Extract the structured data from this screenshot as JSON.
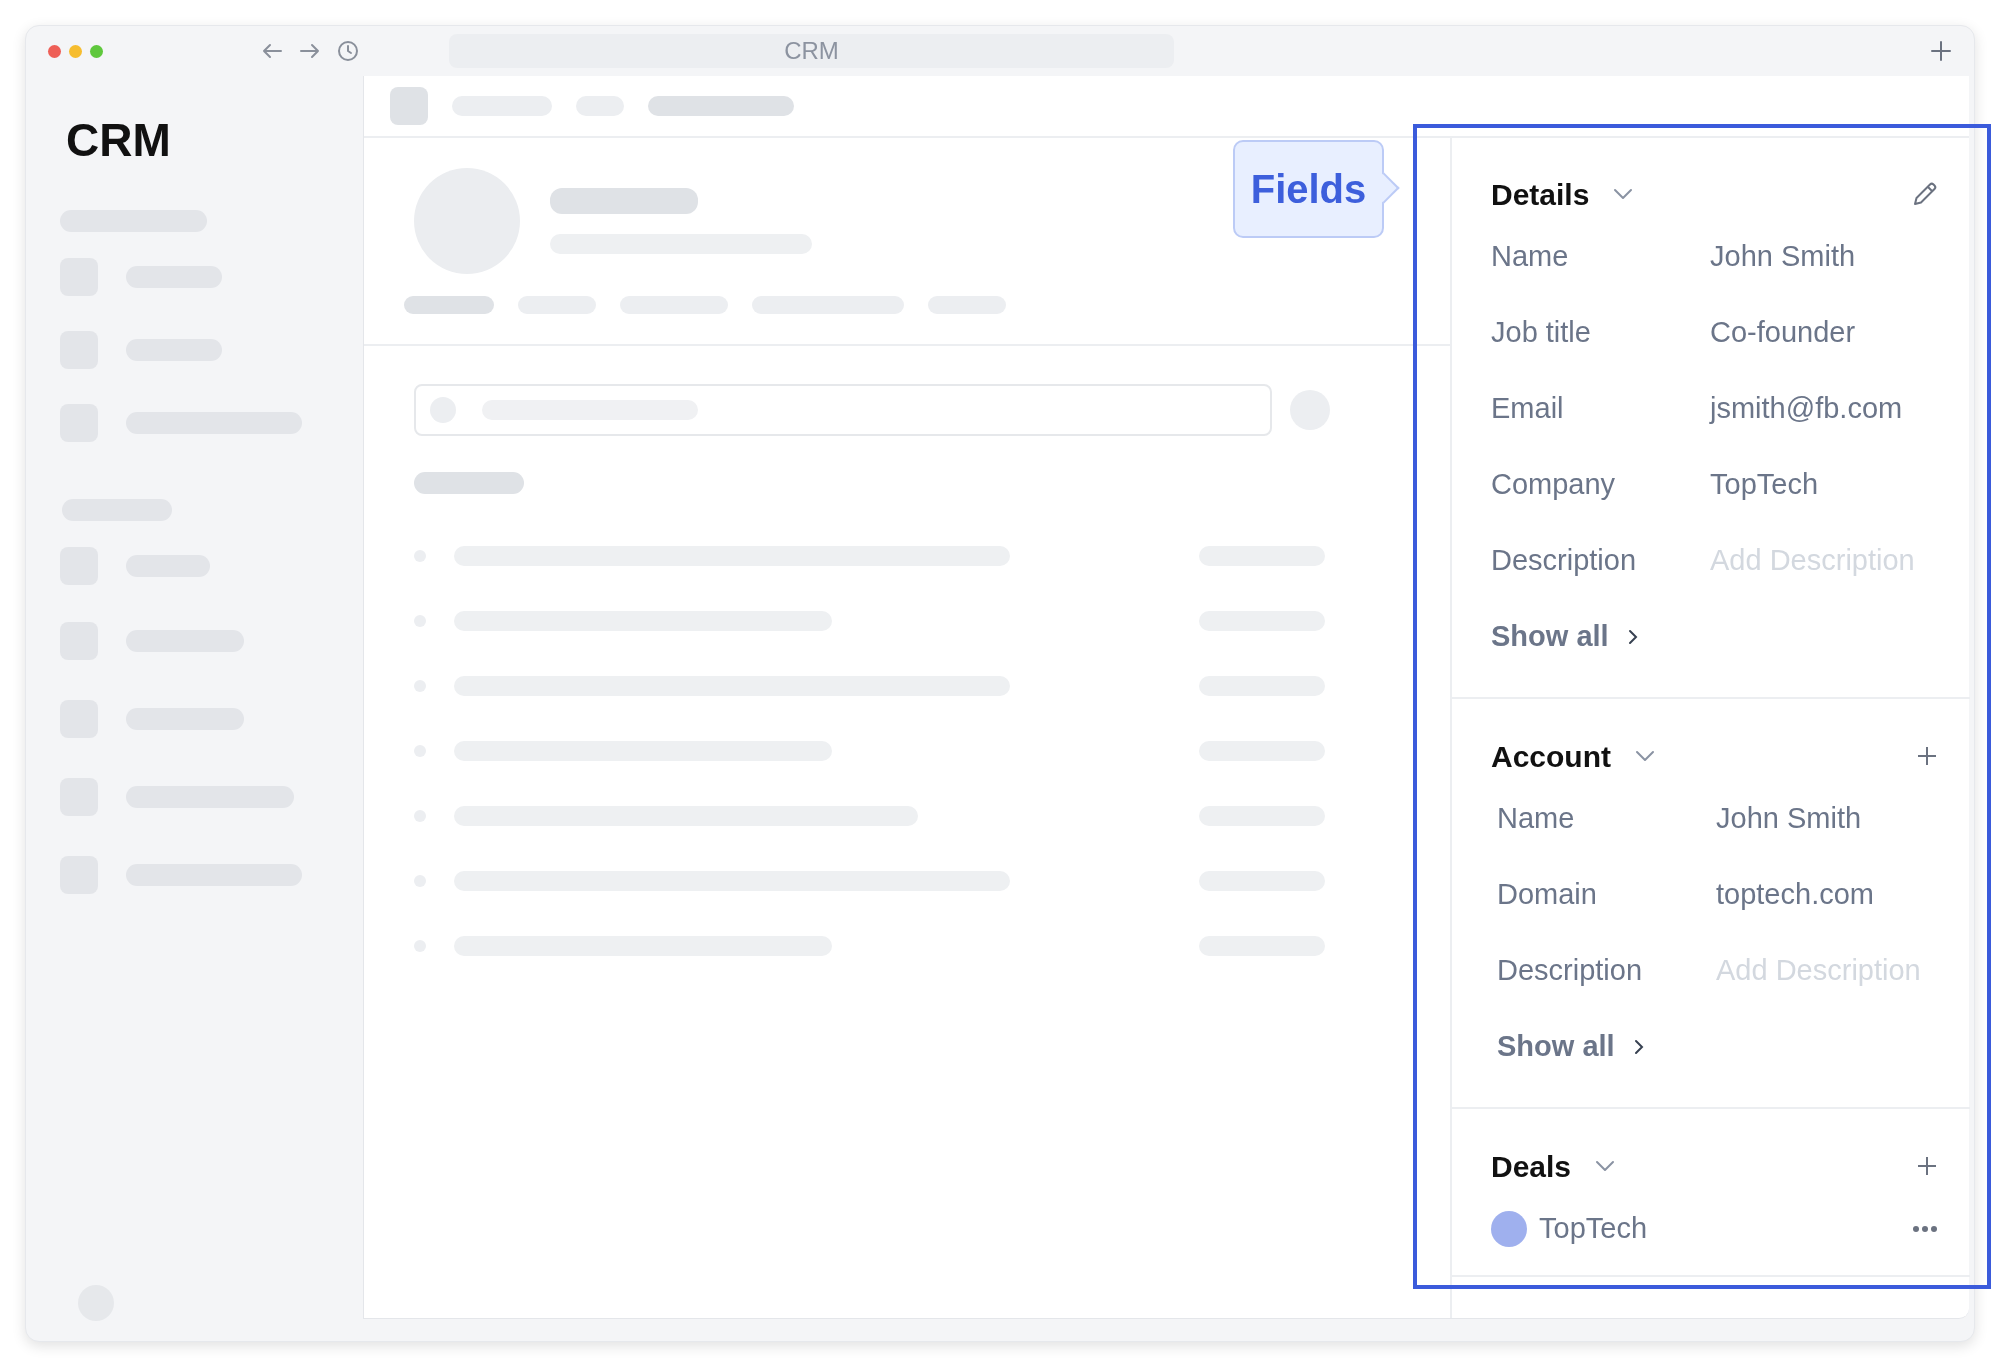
{
  "window": {
    "title": "CRM"
  },
  "sidebar": {
    "title": "CRM"
  },
  "callout": {
    "label": "Fields"
  },
  "sections": [
    {
      "kind": "fields",
      "title": "Details",
      "fields": [
        {
          "label": "Name",
          "value": "John Smith"
        },
        {
          "label": "Job title",
          "value": "Co-founder"
        },
        {
          "label": "Email",
          "value": "jsmith@fb.com"
        },
        {
          "label": "Company",
          "value": "TopTech"
        },
        {
          "label": "Description",
          "placeholder": "Add Description"
        }
      ],
      "show_all": "Show all"
    },
    {
      "kind": "fields",
      "title": "Account",
      "fields": [
        {
          "label": "Name",
          "value": "John Smith"
        },
        {
          "label": "Domain",
          "value": "toptech.com"
        },
        {
          "label": "Description",
          "placeholder": "Add Description"
        }
      ],
      "show_all": "Show all"
    },
    {
      "kind": "deals",
      "title": "Deals",
      "deals": [
        {
          "name": "TopTech",
          "color": "#9fb0ee"
        }
      ]
    }
  ]
}
